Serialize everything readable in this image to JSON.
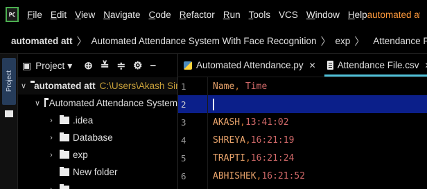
{
  "menubar": {
    "logo": "PC",
    "items": [
      {
        "mn": "F",
        "rest": "ile"
      },
      {
        "mn": "E",
        "rest": "dit"
      },
      {
        "mn": "V",
        "rest": "iew"
      },
      {
        "mn": "N",
        "rest": "avigate"
      },
      {
        "mn": "C",
        "rest": "ode"
      },
      {
        "mn": "R",
        "rest": "efactor"
      },
      {
        "mn": "R",
        "rest": "un"
      },
      {
        "mn": "T",
        "rest": "ools"
      },
      {
        "mn": "",
        "rest": "VCS"
      },
      {
        "mn": "W",
        "rest": "indow"
      },
      {
        "mn": "H",
        "rest": "elp"
      }
    ],
    "project_title": "automated att - "
  },
  "breadcrumb": {
    "root": "automated att",
    "folder": "Automated Attendance System With Face Recognition",
    "subfolder": "exp",
    "file": "Attendance File.csv"
  },
  "tool_stripe": {
    "project_tab": "Project"
  },
  "project_panel": {
    "view_label": "Project",
    "tree": {
      "root": {
        "label": "automated att",
        "path": "C:\\Users\\Akash Sin"
      },
      "child": {
        "label": "Automated Attendance System"
      },
      "items": [
        {
          "label": ".idea"
        },
        {
          "label": "Database"
        },
        {
          "label": "exp"
        },
        {
          "label": "New folder"
        }
      ]
    }
  },
  "tabs": [
    {
      "label": "Automated Attendance.py",
      "icon": "python-file-icon"
    },
    {
      "label": "Attendance File.csv",
      "icon": "csv-file-icon",
      "active": true
    }
  ],
  "editor": {
    "lines": [
      {
        "no": "1",
        "name": "Name",
        "sep": ", ",
        "time": "Time"
      },
      {
        "no": "2",
        "name": "",
        "sep": "",
        "time": ""
      },
      {
        "no": "3",
        "name": "AKASH",
        "sep": ",",
        "time": "13:41:02"
      },
      {
        "no": "4",
        "name": "SHREYA",
        "sep": ",",
        "time": "16:21:19"
      },
      {
        "no": "5",
        "name": "TRAPTI",
        "sep": ",",
        "time": "16:21:24"
      },
      {
        "no": "6",
        "name": "ABHISHEK",
        "sep": ",",
        "time": "16:21:52"
      }
    ],
    "current_line": 2
  },
  "colors": {
    "accent": "#4fc1d9",
    "project_title": "#ff9a3c",
    "current_line_bg": "#0b1f8a",
    "path_hint": "#c9a13a"
  }
}
